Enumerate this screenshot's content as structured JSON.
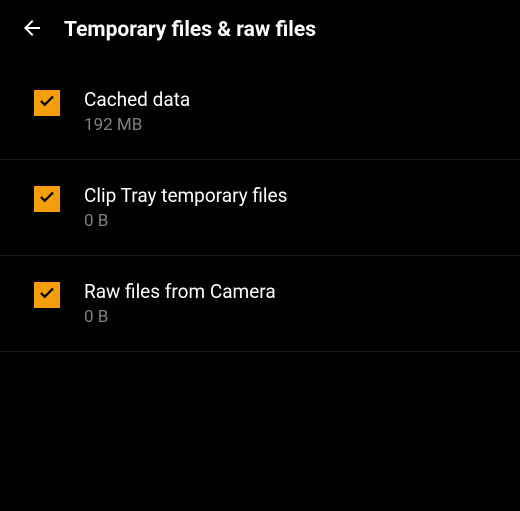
{
  "header": {
    "title": "Temporary files & raw files"
  },
  "items": [
    {
      "label": "Cached data",
      "size": "192 MB",
      "checked": true
    },
    {
      "label": "Clip Tray temporary files",
      "size": "0 B",
      "checked": true
    },
    {
      "label": "Raw files from Camera",
      "size": "0 B",
      "checked": true
    }
  ],
  "colors": {
    "accent": "#f59e0b",
    "background": "#000000",
    "text": "#ffffff",
    "secondary": "#808080"
  }
}
